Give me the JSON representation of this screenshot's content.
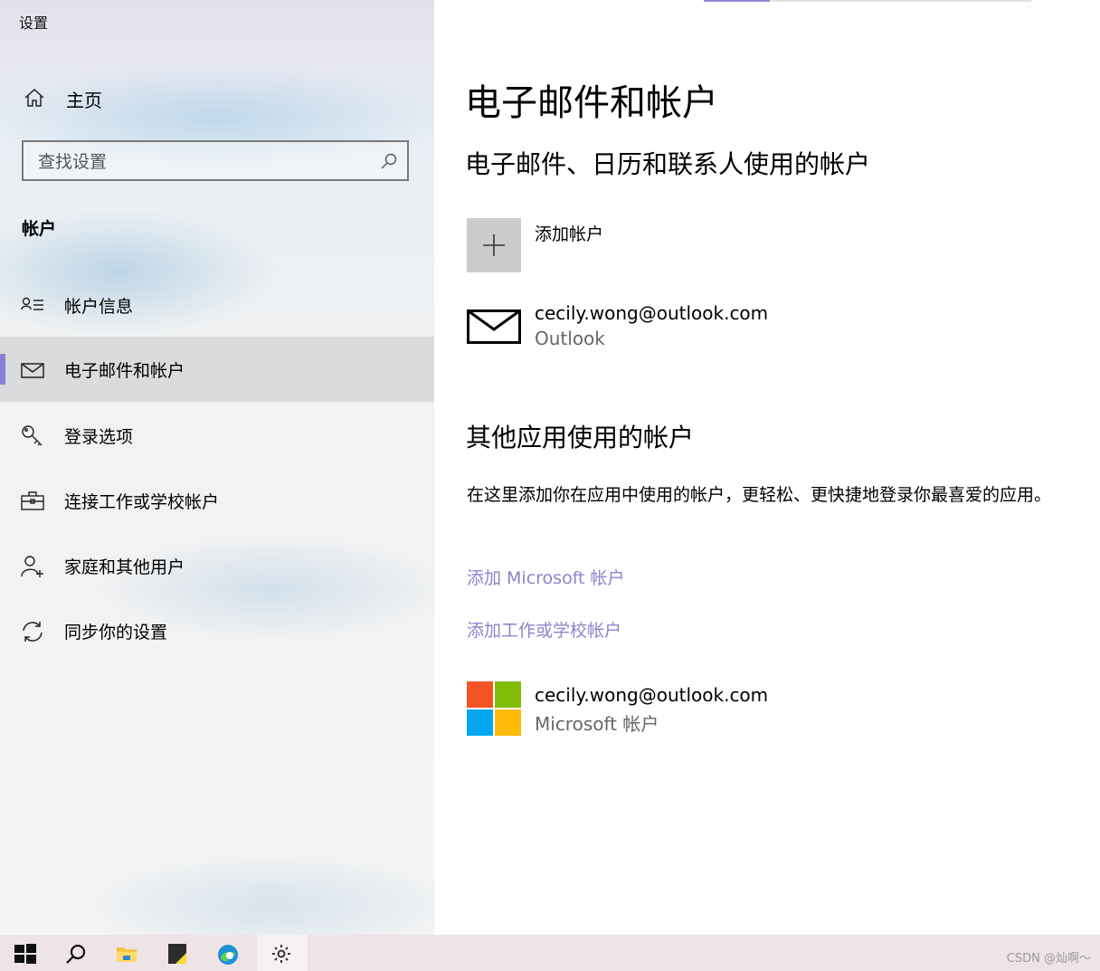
{
  "window": {
    "title": "设置"
  },
  "sidebar": {
    "home_label": "主页",
    "search_placeholder": "查找设置",
    "section_title": "帐户",
    "items": [
      {
        "label": "帐户信息",
        "icon": "account-info-icon"
      },
      {
        "label": "电子邮件和帐户",
        "icon": "mail-icon",
        "selected": true
      },
      {
        "label": "登录选项",
        "icon": "key-icon"
      },
      {
        "label": "连接工作或学校帐户",
        "icon": "briefcase-icon"
      },
      {
        "label": "家庭和其他用户",
        "icon": "add-person-icon"
      },
      {
        "label": "同步你的设置",
        "icon": "sync-icon"
      }
    ]
  },
  "main": {
    "title": "电子邮件和帐户",
    "email_section": {
      "heading": "电子邮件、日历和联系人使用的帐户",
      "add_label": "添加帐户",
      "accounts": [
        {
          "email": "cecily.wong@outlook.com",
          "type": "Outlook"
        }
      ]
    },
    "other_section": {
      "heading": "其他应用使用的帐户",
      "description": "在这里添加你在应用中使用的帐户，更轻松、更快捷地登录你最喜爱的应用。",
      "links": [
        "添加 Microsoft 帐户",
        "添加工作或学校帐户"
      ],
      "accounts": [
        {
          "email": "cecily.wong@outlook.com",
          "type": "Microsoft 帐户"
        }
      ]
    }
  },
  "taskbar": {
    "apps": [
      "start-icon",
      "search-icon",
      "file-explorer-icon",
      "sticky-notes-icon",
      "edge-icon",
      "settings-gear-icon"
    ],
    "watermark": "CSDN @灿啊～"
  },
  "colors": {
    "accent": "#8a7fd6",
    "link": "#8a84cc",
    "ms_red": "#f35325",
    "ms_green": "#81bc06",
    "ms_blue": "#05a6f0",
    "ms_yellow": "#ffba08"
  }
}
